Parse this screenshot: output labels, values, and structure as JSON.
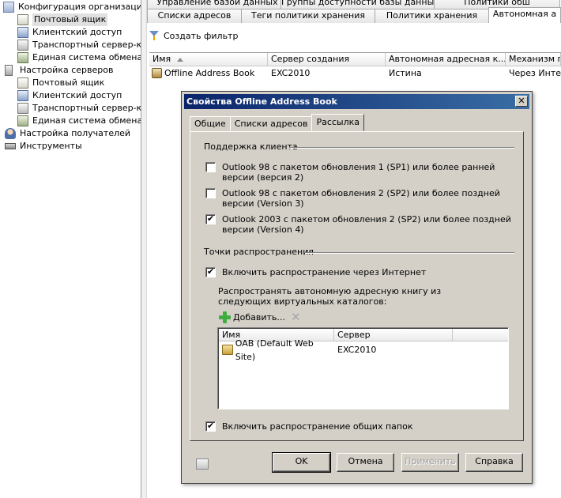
{
  "tree": {
    "items": [
      {
        "label": "Конфигурация организации",
        "icon": "org-icon"
      },
      {
        "label": "Почтовый ящик",
        "icon": "mailbox-icon",
        "selected": true
      },
      {
        "label": "Клиентский доступ",
        "icon": "client-access-icon"
      },
      {
        "label": "Транспортный сервер-кон",
        "icon": "hub-transport-icon"
      },
      {
        "label": "Единая система обмена со",
        "icon": "unified-messaging-icon"
      },
      {
        "label": "Настройка серверов",
        "icon": "server-icon"
      },
      {
        "label": "Почтовый ящик",
        "icon": "mailbox-icon"
      },
      {
        "label": "Клиентский доступ",
        "icon": "client-access-icon"
      },
      {
        "label": "Транспортный сервер-кон",
        "icon": "hub-transport-icon"
      },
      {
        "label": "Единая система обмена со",
        "icon": "unified-messaging-icon"
      },
      {
        "label": "Настройка получателей",
        "icon": "recipient-icon"
      },
      {
        "label": "Инструменты",
        "icon": "tools-icon"
      }
    ]
  },
  "main": {
    "tabs_row1": [
      "Управление базой данных",
      "Группы доступности базы данных",
      "Политики обш"
    ],
    "tabs_row2": [
      "Списки адресов",
      "Теги политики хранения",
      "Политики хранения",
      "Автономная а"
    ],
    "active_tab": "Автономная а",
    "toolbar": {
      "create_filter": "Создать фильтр"
    },
    "columns": [
      "Имя",
      "Сервер создания",
      "Автономная адресная к...",
      "Механизм пер"
    ],
    "rows": [
      {
        "name": "Offline Address Book",
        "server": "EXC2010",
        "default": "Истина",
        "mechanism": "Через Интерн"
      }
    ]
  },
  "dialog": {
    "title": "Свойства Offline Address Book",
    "close": "✕",
    "tabs": [
      "Общие",
      "Списки адресов",
      "Рассылка"
    ],
    "active_tab": "Рассылка",
    "client_support": {
      "label": "Поддержка клиента",
      "options": [
        {
          "text": "Outlook 98 с пакетом обновления 1 (SP1) или более ранней версии (версия 2)",
          "checked": false
        },
        {
          "text": "Outlook 98 с пакетом обновления 2 (SP2) или более поздней версии (Version 3)",
          "checked": false
        },
        {
          "text": "Outlook 2003 с пакетом обновления 2 (SP2) или более поздней версии (Version 4)",
          "checked": true
        }
      ]
    },
    "distribution": {
      "label": "Точки распространения",
      "web_label": "Включить распространение через Интернет",
      "web_checked": true,
      "description": "Распространять автономную адресную книгу из следующих виртуальных каталогов:",
      "add_label": "Добавить...",
      "columns": [
        "Имя",
        "Сервер"
      ],
      "rows": [
        {
          "name": "OAB (Default Web Site)",
          "server": "EXC2010"
        }
      ],
      "public_folder_label": "Включить распространение общих папок",
      "public_folder_checked": true
    },
    "buttons": {
      "ok": "OK",
      "cancel": "Отмена",
      "apply": "Применить",
      "help": "Справка"
    }
  }
}
